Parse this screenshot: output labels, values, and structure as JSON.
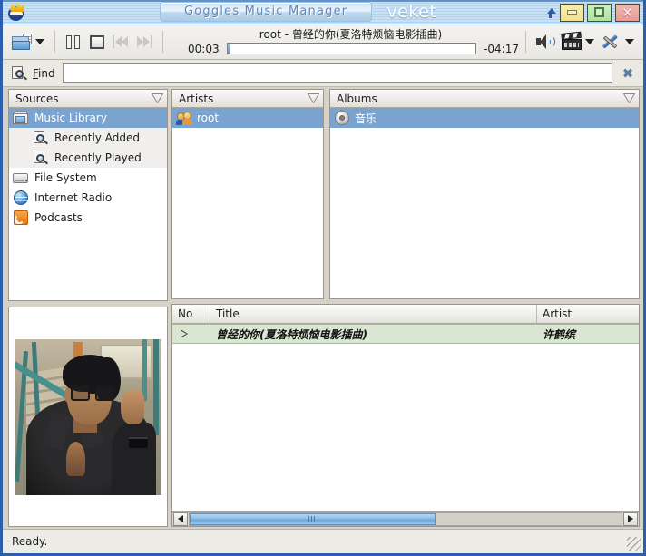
{
  "window": {
    "app_icon": "bird-logo-icon",
    "title": "Goggles  Music  Manager",
    "wm_name": "veket",
    "shade_button": "shade-window",
    "minimize_label": "_",
    "maximize_label": "□",
    "close_label": "✕"
  },
  "toolbar": {
    "open_icon": "open-folder-icon",
    "open_dropdown": "open-folder-dropdown",
    "pause_icon": "pause-icon",
    "stop_icon": "stop-icon",
    "previous_icon": "previous-track-icon",
    "next_icon": "next-track-icon",
    "now_playing": "root - 曾经的你(夏洛特烦恼电影插曲)",
    "elapsed": "00:03",
    "remaining": "-04:17",
    "progress_percent": 1.2,
    "volume_icon": "speaker-volume-icon",
    "media_icon": "film-clapper-icon",
    "tools_icon": "wrench-screwdriver-icon"
  },
  "find": {
    "icon": "find-search-icon",
    "label_prefix": "F",
    "label_rest": "ind",
    "value": "",
    "placeholder": "",
    "clear_icon": "clear-find-icon"
  },
  "sources": {
    "header": "Sources",
    "filter_icon": "filter-funnel-icon",
    "items": [
      {
        "label": "Music Library",
        "icon": "music-library-icon",
        "selected": true,
        "child": false
      },
      {
        "label": "Recently Added",
        "icon": "recently-added-icon",
        "selected": false,
        "child": true
      },
      {
        "label": "Recently Played",
        "icon": "recently-played-icon",
        "selected": false,
        "child": true
      },
      {
        "label": "File System",
        "icon": "file-system-icon",
        "selected": false,
        "child": false
      },
      {
        "label": "Internet Radio",
        "icon": "internet-radio-icon",
        "selected": false,
        "child": false
      },
      {
        "label": "Podcasts",
        "icon": "podcasts-icon",
        "selected": false,
        "child": false
      }
    ]
  },
  "artwork": {
    "alt": "album-cover-man-in-black-shirt-on-stairs"
  },
  "artists": {
    "header": "Artists",
    "filter_icon": "filter-funnel-icon",
    "items": [
      {
        "label": "root",
        "icon": "artist-people-icon",
        "selected": true
      }
    ]
  },
  "albums": {
    "header": "Albums",
    "filter_icon": "filter-funnel-icon",
    "items": [
      {
        "label": "音乐",
        "icon": "album-cd-icon",
        "selected": true
      }
    ]
  },
  "tracks": {
    "columns": [
      "No",
      "Title",
      "Artist"
    ],
    "rows": [
      {
        "no": "",
        "playing_icon": "now-playing-triangle-icon",
        "title": "曾经的你(夏洛特烦恼电影插曲)",
        "artist": "许鹤缤",
        "selected": true
      }
    ],
    "hscroll": {
      "left_arrow": "scroll-left-icon",
      "right_arrow": "scroll-right-icon",
      "thumb_percent": 57
    }
  },
  "status": {
    "message": "Ready.",
    "resize_grip": "resize-grip-icon"
  },
  "colors": {
    "selection_blue": "#7ba3d0",
    "playing_row_green": "#d9e7d2",
    "frame_blue": "#2b5fad",
    "titlebar_blue": "#b6d4ee"
  }
}
